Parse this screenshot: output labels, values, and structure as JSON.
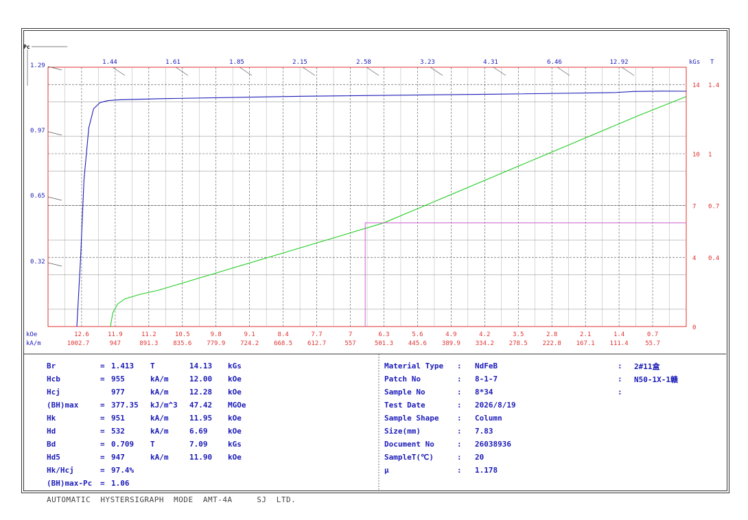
{
  "chart_data": {
    "type": "line",
    "pc_label": "Pc",
    "pc_ticks": [
      "1.29",
      "0.97",
      "0.65",
      "0.32"
    ],
    "top_ticks": [
      "1.44",
      "1.61",
      "1.85",
      "2.15",
      "2.58",
      "3.23",
      "4.31",
      "6.46",
      "12.92"
    ],
    "top_units": [
      "kGs",
      "T"
    ],
    "right_kgs": [
      "14",
      "10",
      "7",
      "4",
      "0"
    ],
    "right_t": [
      "1.4",
      "1",
      "0.7",
      "0.4"
    ],
    "koe_label": "kOe",
    "kam_label": "kA/m",
    "koe_ticks": [
      "12.6",
      "11.9",
      "11.2",
      "10.5",
      "9.8",
      "9.1",
      "8.4",
      "7.7",
      "7",
      "6.3",
      "5.6",
      "4.9",
      "4.2",
      "3.5",
      "2.8",
      "2.1",
      "1.4",
      "0.7"
    ],
    "kam_ticks": [
      "1002.7",
      "947",
      "891.3",
      "835.6",
      "779.9",
      "724.2",
      "668.5",
      "612.7",
      "557",
      "501.3",
      "445.6",
      "389.9",
      "334.2",
      "278.5",
      "222.8",
      "167.1",
      "111.4",
      "55.7"
    ],
    "xlim_koe": [
      13.3,
      0
    ],
    "ylim_kgs": [
      0,
      15
    ],
    "series": [
      {
        "color": "#1a1ab8",
        "x": [
          12.7,
          12.62,
          12.55,
          12.45,
          12.35,
          12.22,
          12.05,
          11.8,
          11.0,
          8.0,
          4.0,
          1.5,
          1.1,
          0.5,
          0.0
        ],
        "y": [
          0,
          4.0,
          8.5,
          11.5,
          12.6,
          12.95,
          13.07,
          13.12,
          13.18,
          13.32,
          13.44,
          13.53,
          13.6,
          13.62,
          13.61
        ]
      },
      {
        "color": "#22cc22",
        "x": [
          12.0,
          11.95,
          11.85,
          11.7,
          11.4,
          11.0,
          6.3,
          1.0,
          0.0
        ],
        "y": [
          0,
          0.8,
          1.3,
          1.6,
          1.85,
          2.1,
          6.0,
          12.2,
          13.3
        ]
      },
      {
        "color": "#d070d0",
        "x": [
          6.69,
          6.69,
          0.0
        ],
        "y": [
          0,
          6.0,
          6.0
        ]
      }
    ],
    "grid": true
  },
  "params": [
    {
      "name": "Br",
      "eq": "=",
      "v1": "1.413",
      "u1": "T",
      "v2": "14.13",
      "u2": "kGs"
    },
    {
      "name": "Hcb",
      "eq": "=",
      "v1": "955",
      "u1": "kA/m",
      "v2": "12.00",
      "u2": "kOe"
    },
    {
      "name": "Hcj",
      "eq": "",
      "v1": "977",
      "u1": "kA/m",
      "v2": "12.28",
      "u2": "kOe"
    },
    {
      "name": "(BH)max",
      "eq": "=",
      "v1": "377.35",
      "u1": "kJ/m^3",
      "v2": "47.42",
      "u2": "MGOe"
    },
    {
      "name": "Hk",
      "eq": "=",
      "v1": "951",
      "u1": "kA/m",
      "v2": "11.95",
      "u2": "kOe"
    },
    {
      "name": "Hd",
      "eq": "=",
      "v1": "532",
      "u1": "kA/m",
      "v2": "6.69",
      "u2": "kOe"
    },
    {
      "name": "Bd",
      "eq": "=",
      "v1": "0.709",
      "u1": "T",
      "v2": "7.09",
      "u2": "kGs"
    },
    {
      "name": "Hd5",
      "eq": "=",
      "v1": "947",
      "u1": "kA/m",
      "v2": "11.90",
      "u2": "kOe"
    },
    {
      "name": "Hk/Hcj",
      "eq": "=",
      "v1": "97.4%",
      "u1": "",
      "v2": "",
      "u2": ""
    },
    {
      "name": "(BH)max-Pc",
      "eq": "=",
      "v1": "1.06",
      "u1": "",
      "v2": "",
      "u2": ""
    }
  ],
  "sample": [
    {
      "label": "Material Type",
      "colon": ":",
      "value": "NdFeB"
    },
    {
      "label": "Patch No",
      "colon": ":",
      "value": "8-1-7"
    },
    {
      "label": "Sample No",
      "colon": ":",
      "value": "8*34"
    },
    {
      "label": "Test Date",
      "colon": ":",
      "value": "2026/8/19"
    },
    {
      "label": "Sample Shape",
      "colon": ":",
      "value": "Column"
    },
    {
      "label": "Size(mm)",
      "colon": ":",
      "value": "7.83"
    },
    {
      "label": "Document No",
      "colon": ":",
      "value": "26038936"
    },
    {
      "label": "SampleT(℃)",
      "colon": ":",
      "value": "20"
    },
    {
      "label": "μ",
      "colon": ":",
      "value": "1.178"
    }
  ],
  "extra": [
    {
      "colon": ":",
      "value": "2#11盒"
    },
    {
      "colon": ":",
      "value": "N50-1X-1赣"
    },
    {
      "colon": ":",
      "value": ""
    }
  ],
  "footer": "AUTOMATIC  HYSTERSIGRAPH  MODE  AMT-4A     SJ  LTD."
}
